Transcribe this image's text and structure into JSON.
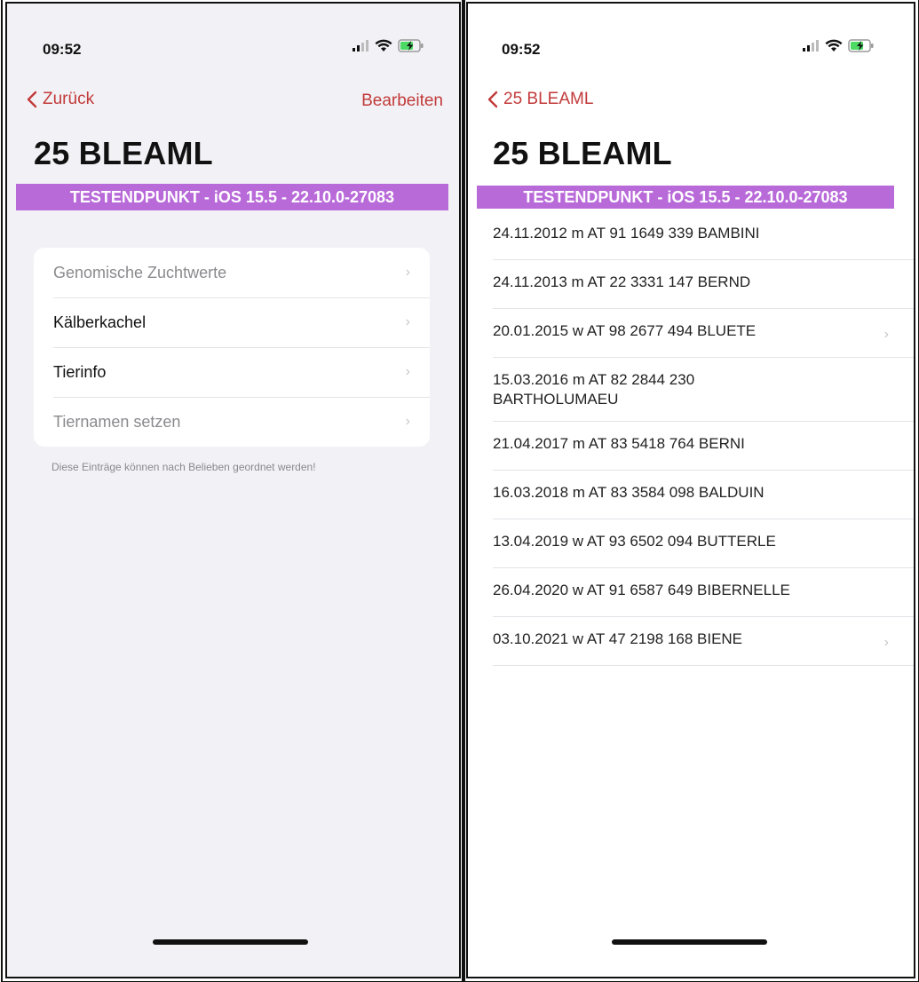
{
  "left_screen": {
    "status": {
      "time": "09:52"
    },
    "nav": {
      "back_label": "Zurück",
      "action_label": "Bearbeiten"
    },
    "title": "25 BLEAML",
    "banner": "TESTENDPUNKT - iOS 15.5 - 22.10.0-27083",
    "menu": [
      {
        "label": "Genomische Zuchtwerte",
        "enabled": false
      },
      {
        "label": "Kälberkachel",
        "enabled": true
      },
      {
        "label": "Tierinfo",
        "enabled": true
      },
      {
        "label": "Tiernamen setzen",
        "enabled": false
      }
    ],
    "footnote": "Diese Einträge können nach Belieben geordnet werden!"
  },
  "right_screen": {
    "status": {
      "time": "09:52"
    },
    "nav": {
      "back_label": "25 BLEAML"
    },
    "title": "25 BLEAML",
    "banner": "TESTENDPUNKT - iOS 15.5 - 22.10.0-27083",
    "offspring": [
      {
        "text": "24.11.2012 m AT 91 1649 339 BAMBINI",
        "has_detail": false
      },
      {
        "text": "24.11.2013 m AT 22 3331 147 BERND",
        "has_detail": false
      },
      {
        "text": "20.01.2015 w AT 98 2677 494 BLUETE",
        "has_detail": true
      },
      {
        "text": "15.03.2016 m AT 82 2844 230 BARTHOLUMAEU",
        "has_detail": false
      },
      {
        "text": "21.04.2017 m AT 83 5418 764 BERNI",
        "has_detail": false
      },
      {
        "text": "16.03.2018 m AT 83 3584 098 BALDUIN",
        "has_detail": false
      },
      {
        "text": "13.04.2019 w AT 93 6502 094 BUTTERLE",
        "has_detail": false
      },
      {
        "text": "26.04.2020 w AT 91 6587 649 BIBERNELLE",
        "has_detail": false
      },
      {
        "text": "03.10.2021 w AT 47 2198 168 BIENE",
        "has_detail": true
      }
    ]
  },
  "colors": {
    "accent": "#c23a3a",
    "banner": "#b96ad9",
    "grouped_background": "#f2f2f6"
  },
  "icons": {
    "back": "chevron-left-icon",
    "row": "chevron-right-icon",
    "signal": "cellular-signal-icon",
    "wifi": "wifi-icon",
    "battery": "battery-charging-icon"
  }
}
